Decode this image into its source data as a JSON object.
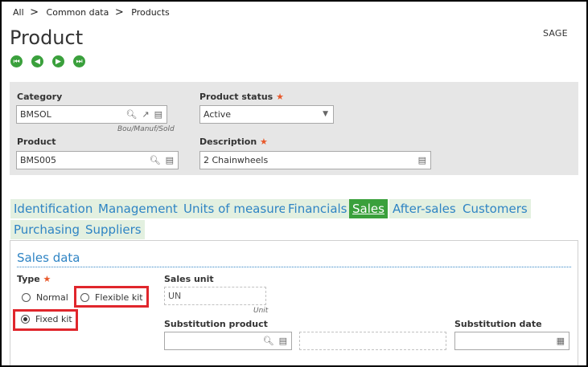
{
  "breadcrumb": {
    "items": [
      "All",
      "Common data",
      "Products"
    ],
    "separator": ">"
  },
  "page": {
    "title": "Product",
    "user": "SAGE"
  },
  "nav_buttons": [
    {
      "icon": "first-record-icon",
      "glyph": "⏮"
    },
    {
      "icon": "previous-record-icon",
      "glyph": "◀"
    },
    {
      "icon": "next-record-icon",
      "glyph": "▶"
    },
    {
      "icon": "last-record-icon",
      "glyph": "⏭"
    }
  ],
  "header": {
    "category": {
      "label": "Category",
      "value": "BMSOL",
      "hint": "Bou/Manuf/Sold"
    },
    "status": {
      "label": "Product status",
      "required": "★",
      "value": "Active"
    },
    "product": {
      "label": "Product",
      "value": "BMS005"
    },
    "description": {
      "label": "Description",
      "required": "★",
      "value": "2 Chainwheels"
    }
  },
  "tabs": [
    {
      "label": "Identification"
    },
    {
      "label": "Management"
    },
    {
      "label": "Units of measure"
    },
    {
      "label": "Financials"
    },
    {
      "label": "Sales",
      "active": true
    },
    {
      "label": "After-sales"
    },
    {
      "label": "Customers"
    },
    {
      "label": "Purchasing"
    },
    {
      "label": "Suppliers"
    }
  ],
  "sales": {
    "section_title": "Sales data",
    "type": {
      "label": "Type",
      "required": "★",
      "options": [
        {
          "label": "Normal",
          "selected": false
        },
        {
          "label": "Flexible kit",
          "selected": false
        },
        {
          "label": "Fixed kit",
          "selected": true
        }
      ]
    },
    "sales_unit": {
      "label": "Sales unit",
      "value": "UN",
      "hint": "Unit"
    },
    "substitution_product": {
      "label": "Substitution product",
      "value": "",
      "desc": ""
    },
    "substitution_date": {
      "label": "Substitution date",
      "value": ""
    }
  },
  "colors": {
    "accent_green": "#3aa03c",
    "link_blue": "#2f84c4",
    "required_orange": "#e8582a",
    "highlight_red": "#e0262c"
  }
}
